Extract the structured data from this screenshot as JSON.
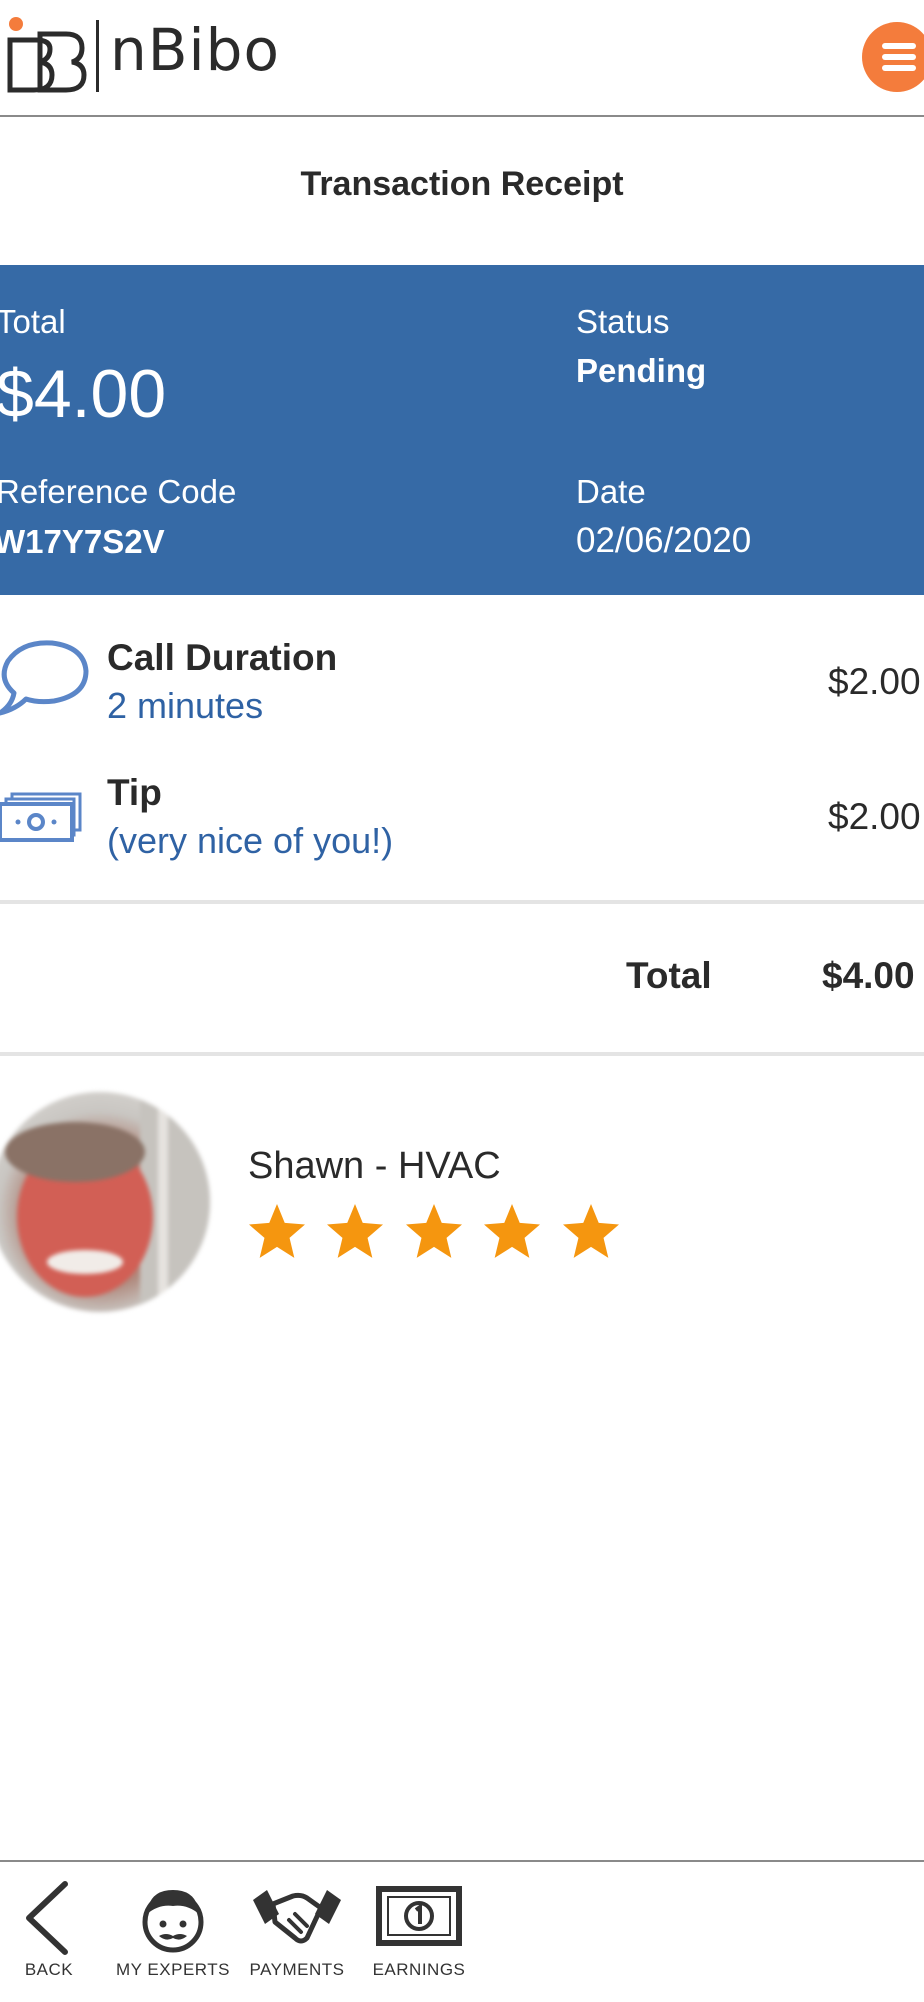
{
  "header": {
    "logo_text": "nBibo",
    "menu_icon": "hamburger-menu-icon",
    "accent_color": "#f47c3c"
  },
  "page_title": "Transaction Receipt",
  "summary": {
    "background_color": "#366aa6",
    "total_label": "Total",
    "total_value": "$4.00",
    "status_label": "Status",
    "status_value": "Pending",
    "reference_label": "Reference Code",
    "reference_value": "W17Y7S2V",
    "date_label": "Date",
    "date_value": "02/06/2020"
  },
  "line_items": [
    {
      "icon": "chat-bubble-icon",
      "title": "Call Duration",
      "subtitle": "2 minutes",
      "amount": "$2.00"
    },
    {
      "icon": "cash-icon",
      "title": "Tip",
      "subtitle": "(very nice of you!)",
      "amount": "$2.00"
    }
  ],
  "totals": {
    "label": "Total",
    "value": "$4.00"
  },
  "expert": {
    "name": "Shawn - HVAC",
    "rating": 5,
    "rating_max": 5,
    "star_color": "#f5960f"
  },
  "bottom_nav": [
    {
      "label": "BACK",
      "icon": "back-arrow-icon"
    },
    {
      "label": "MY EXPERTS",
      "icon": "expert-face-icon"
    },
    {
      "label": "PAYMENTS",
      "icon": "handshake-icon"
    },
    {
      "label": "EARNINGS",
      "icon": "dollar-bill-icon"
    }
  ]
}
